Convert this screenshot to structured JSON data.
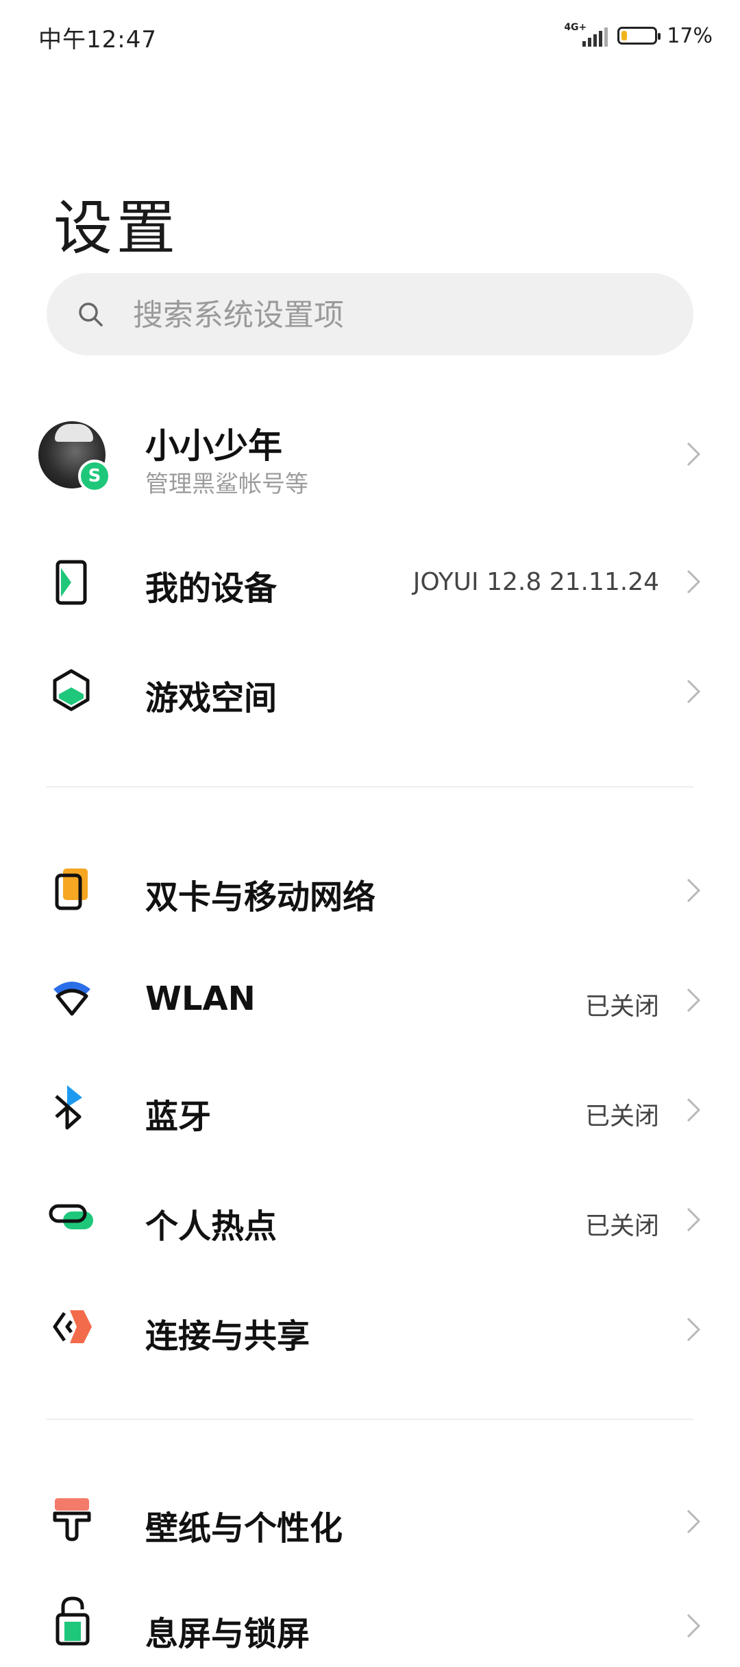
{
  "status_bar": {
    "time": "中午12:47",
    "network": "4G+",
    "battery_percent": "17%",
    "battery_level": 0.17
  },
  "page_title": "设置",
  "search": {
    "placeholder": "搜索系统设置项"
  },
  "account": {
    "name": "小小少年",
    "subtitle": "管理黑鲨帐号等",
    "badge": "S"
  },
  "groups": [
    [
      {
        "label": "我的设备",
        "value": "JOYUI 12.8 21.11.24",
        "icon": "phone-device-icon"
      },
      {
        "label": "游戏空间",
        "value": "",
        "icon": "game-space-hexagon-icon"
      }
    ],
    [
      {
        "label": "双卡与移动网络",
        "value": "",
        "icon": "sim-card-icon"
      },
      {
        "label": "WLAN",
        "value": "已关闭",
        "icon": "wifi-icon"
      },
      {
        "label": "蓝牙",
        "value": "已关闭",
        "icon": "bluetooth-icon"
      },
      {
        "label": "个人热点",
        "value": "已关闭",
        "icon": "hotspot-icon"
      },
      {
        "label": "连接与共享",
        "value": "",
        "icon": "connection-share-icon"
      }
    ],
    [
      {
        "label": "壁纸与个性化",
        "value": "",
        "icon": "wallpaper-brush-icon"
      },
      {
        "label": "息屏与锁屏",
        "value": "",
        "icon": "lock-screen-icon"
      }
    ]
  ],
  "colors": {
    "accent_green": "#1ec77a",
    "wifi_blue": "#2b6ee8",
    "bluetooth_blue": "#1e9bf0",
    "sim_orange": "#f5a623",
    "share_orange": "#f26b4a",
    "brush_red": "#f47a6a"
  }
}
